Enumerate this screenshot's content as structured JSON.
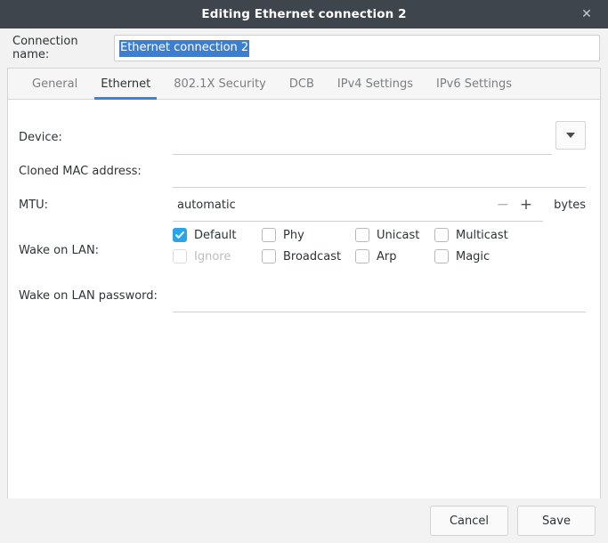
{
  "titlebar": {
    "title": "Editing Ethernet connection 2",
    "close_label": "✕"
  },
  "connection_name": {
    "label": "Connection name:",
    "value": "Ethernet connection 2",
    "selected": true,
    "selection_color": "#3c7ed0"
  },
  "tabs": [
    {
      "label": "General",
      "active": false
    },
    {
      "label": "Ethernet",
      "active": true
    },
    {
      "label": "802.1X Security",
      "active": false
    },
    {
      "label": "DCB",
      "active": false
    },
    {
      "label": "IPv4 Settings",
      "active": false
    },
    {
      "label": "IPv6 Settings",
      "active": false
    }
  ],
  "accent_color": "#3584e4",
  "checkbox_color": "#2aa3e8",
  "form": {
    "device": {
      "label": "Device:",
      "value": "",
      "dropdown_icon": "chevron-down-icon"
    },
    "cloned_mac": {
      "label": "Cloned MAC address:",
      "value": ""
    },
    "mtu": {
      "label": "MTU:",
      "value": "automatic",
      "minus_label": "−",
      "plus_label": "+",
      "unit": "bytes"
    },
    "wake_on_lan": {
      "label": "Wake on LAN:",
      "options": [
        {
          "label": "Default",
          "checked": true,
          "disabled": false
        },
        {
          "label": "Phy",
          "checked": false,
          "disabled": false
        },
        {
          "label": "Unicast",
          "checked": false,
          "disabled": false
        },
        {
          "label": "Multicast",
          "checked": false,
          "disabled": false
        },
        {
          "label": "Ignore",
          "checked": false,
          "disabled": true
        },
        {
          "label": "Broadcast",
          "checked": false,
          "disabled": false
        },
        {
          "label": "Arp",
          "checked": false,
          "disabled": false
        },
        {
          "label": "Magic",
          "checked": false,
          "disabled": false
        }
      ]
    },
    "wol_password": {
      "label": "Wake on LAN password:",
      "value": ""
    }
  },
  "footer": {
    "cancel_label": "Cancel",
    "save_label": "Save"
  }
}
